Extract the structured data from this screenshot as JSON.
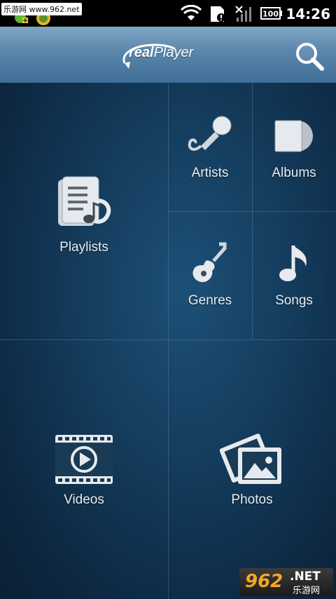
{
  "status_bar": {
    "watermark": "乐游网 www.962.net",
    "time": "14:26",
    "battery_label": "100"
  },
  "header": {
    "logo_text_prefix": "real",
    "logo_text_suffix": "Player",
    "search_icon": "magnifier-icon"
  },
  "tiles": {
    "playlists": {
      "label": "Playlists",
      "icon": "playlist-icon"
    },
    "artists": {
      "label": "Artists",
      "icon": "microphone-icon"
    },
    "albums": {
      "label": "Albums",
      "icon": "album-icon"
    },
    "genres": {
      "label": "Genres",
      "icon": "guitar-icon"
    },
    "songs": {
      "label": "Songs",
      "icon": "music-note-icon"
    },
    "videos": {
      "label": "Videos",
      "icon": "film-icon"
    },
    "photos": {
      "label": "Photos",
      "icon": "photo-icon"
    }
  },
  "watermark_bottom": {
    "number": "962",
    "suffix": ".NET",
    "cn": "乐游网"
  },
  "colors": {
    "header_top": "#7fa6c4",
    "header_bottom": "#3f6e96",
    "background_center": "#1d5076",
    "background_edge": "#0a2035",
    "label": "#e6ecf1"
  }
}
